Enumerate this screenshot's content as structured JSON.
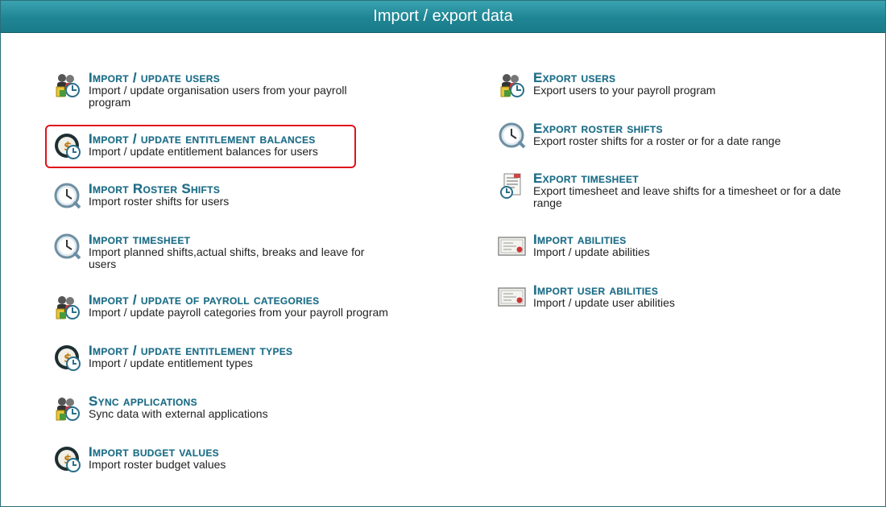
{
  "window": {
    "title": "Import / export data"
  },
  "left_items": [
    {
      "title": "Import / update users",
      "desc": "Import / update organisation users from your payroll program",
      "icon": "users-payroll-icon"
    },
    {
      "title": "Import / update entitlement balances",
      "desc": "Import / update entitlement balances for users",
      "icon": "money-clock-icon"
    },
    {
      "title": "Import Roster Shifts",
      "desc": "Import roster shifts for users",
      "icon": "clock-icon"
    },
    {
      "title": "Import timesheet",
      "desc": "Import planned shifts,actual shifts, breaks and leave for users",
      "icon": "clock-icon"
    },
    {
      "title": "Import / update of payroll categories",
      "desc": "Import / update payroll categories from your payroll program",
      "icon": "users-payroll-icon"
    },
    {
      "title": "Import / update entitlement types",
      "desc": "Import / update entitlement types",
      "icon": "money-clock-icon"
    },
    {
      "title": "Sync applications",
      "desc": "Sync data with external applications",
      "icon": "users-payroll-icon"
    },
    {
      "title": "Import budget values",
      "desc": "Import roster budget values",
      "icon": "money-clock-icon"
    }
  ],
  "right_items": [
    {
      "title": "Export users",
      "desc": "Export users to your payroll program",
      "icon": "users-payroll-icon"
    },
    {
      "title": "Export roster shifts",
      "desc": "Export roster shifts for a roster or for a date range",
      "icon": "clock-icon"
    },
    {
      "title": "Export timesheet",
      "desc": "Export timesheet and leave shifts for a timesheet or for a date range",
      "icon": "timesheet-document-icon"
    },
    {
      "title": "Import abilities",
      "desc": "Import / update abilities",
      "icon": "certificate-icon"
    },
    {
      "title": "Import user abilities",
      "desc": "Import / update user abilities",
      "icon": "certificate-icon"
    }
  ],
  "colors": {
    "titlebar": "#1f8594",
    "link": "#1d6c86",
    "highlight": "#e0121b"
  }
}
